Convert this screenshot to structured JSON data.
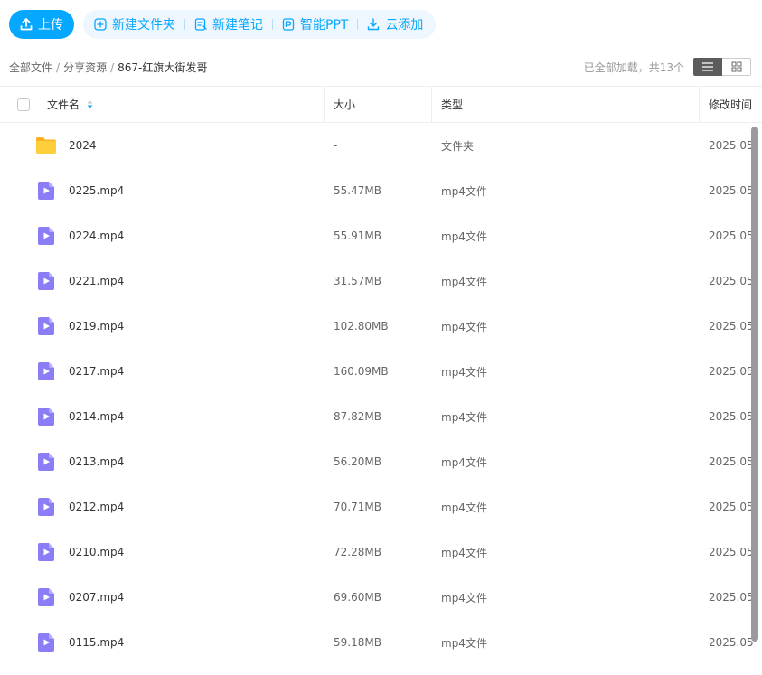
{
  "toolbar": {
    "upload_label": "上传",
    "new_folder_label": "新建文件夹",
    "new_note_label": "新建笔记",
    "smart_ppt_label": "智能PPT",
    "cloud_add_label": "云添加"
  },
  "breadcrumb": {
    "items": [
      "全部文件",
      "分享资源",
      "867-红旗大街发哥"
    ],
    "separator": "/"
  },
  "status": {
    "count_text": "已全部加载，共13个"
  },
  "table": {
    "columns": {
      "name": "文件名",
      "size": "大小",
      "type": "类型",
      "modified": "修改时间"
    },
    "rows": [
      {
        "icon": "folder-icon",
        "name": "2024",
        "size": "-",
        "type": "文件夹",
        "modified": "2025.05"
      },
      {
        "icon": "video-file-icon",
        "name": "0225.mp4",
        "size": "55.47MB",
        "type": "mp4文件",
        "modified": "2025.05"
      },
      {
        "icon": "video-file-icon",
        "name": "0224.mp4",
        "size": "55.91MB",
        "type": "mp4文件",
        "modified": "2025.05"
      },
      {
        "icon": "video-file-icon",
        "name": "0221.mp4",
        "size": "31.57MB",
        "type": "mp4文件",
        "modified": "2025.05"
      },
      {
        "icon": "video-file-icon",
        "name": "0219.mp4",
        "size": "102.80MB",
        "type": "mp4文件",
        "modified": "2025.05"
      },
      {
        "icon": "video-file-icon",
        "name": "0217.mp4",
        "size": "160.09MB",
        "type": "mp4文件",
        "modified": "2025.05"
      },
      {
        "icon": "video-file-icon",
        "name": "0214.mp4",
        "size": "87.82MB",
        "type": "mp4文件",
        "modified": "2025.05"
      },
      {
        "icon": "video-file-icon",
        "name": "0213.mp4",
        "size": "56.20MB",
        "type": "mp4文件",
        "modified": "2025.05"
      },
      {
        "icon": "video-file-icon",
        "name": "0212.mp4",
        "size": "70.71MB",
        "type": "mp4文件",
        "modified": "2025.05"
      },
      {
        "icon": "video-file-icon",
        "name": "0210.mp4",
        "size": "72.28MB",
        "type": "mp4文件",
        "modified": "2025.05"
      },
      {
        "icon": "video-file-icon",
        "name": "0207.mp4",
        "size": "69.60MB",
        "type": "mp4文件",
        "modified": "2025.05"
      },
      {
        "icon": "video-file-icon",
        "name": "0115.mp4",
        "size": "59.18MB",
        "type": "mp4文件",
        "modified": "2025.05"
      }
    ]
  },
  "colors": {
    "accent": "#06a7ff",
    "tool_group_bg": "#eef7ff",
    "folder": "#ffc83d",
    "video_icon": "#8b7df5"
  }
}
